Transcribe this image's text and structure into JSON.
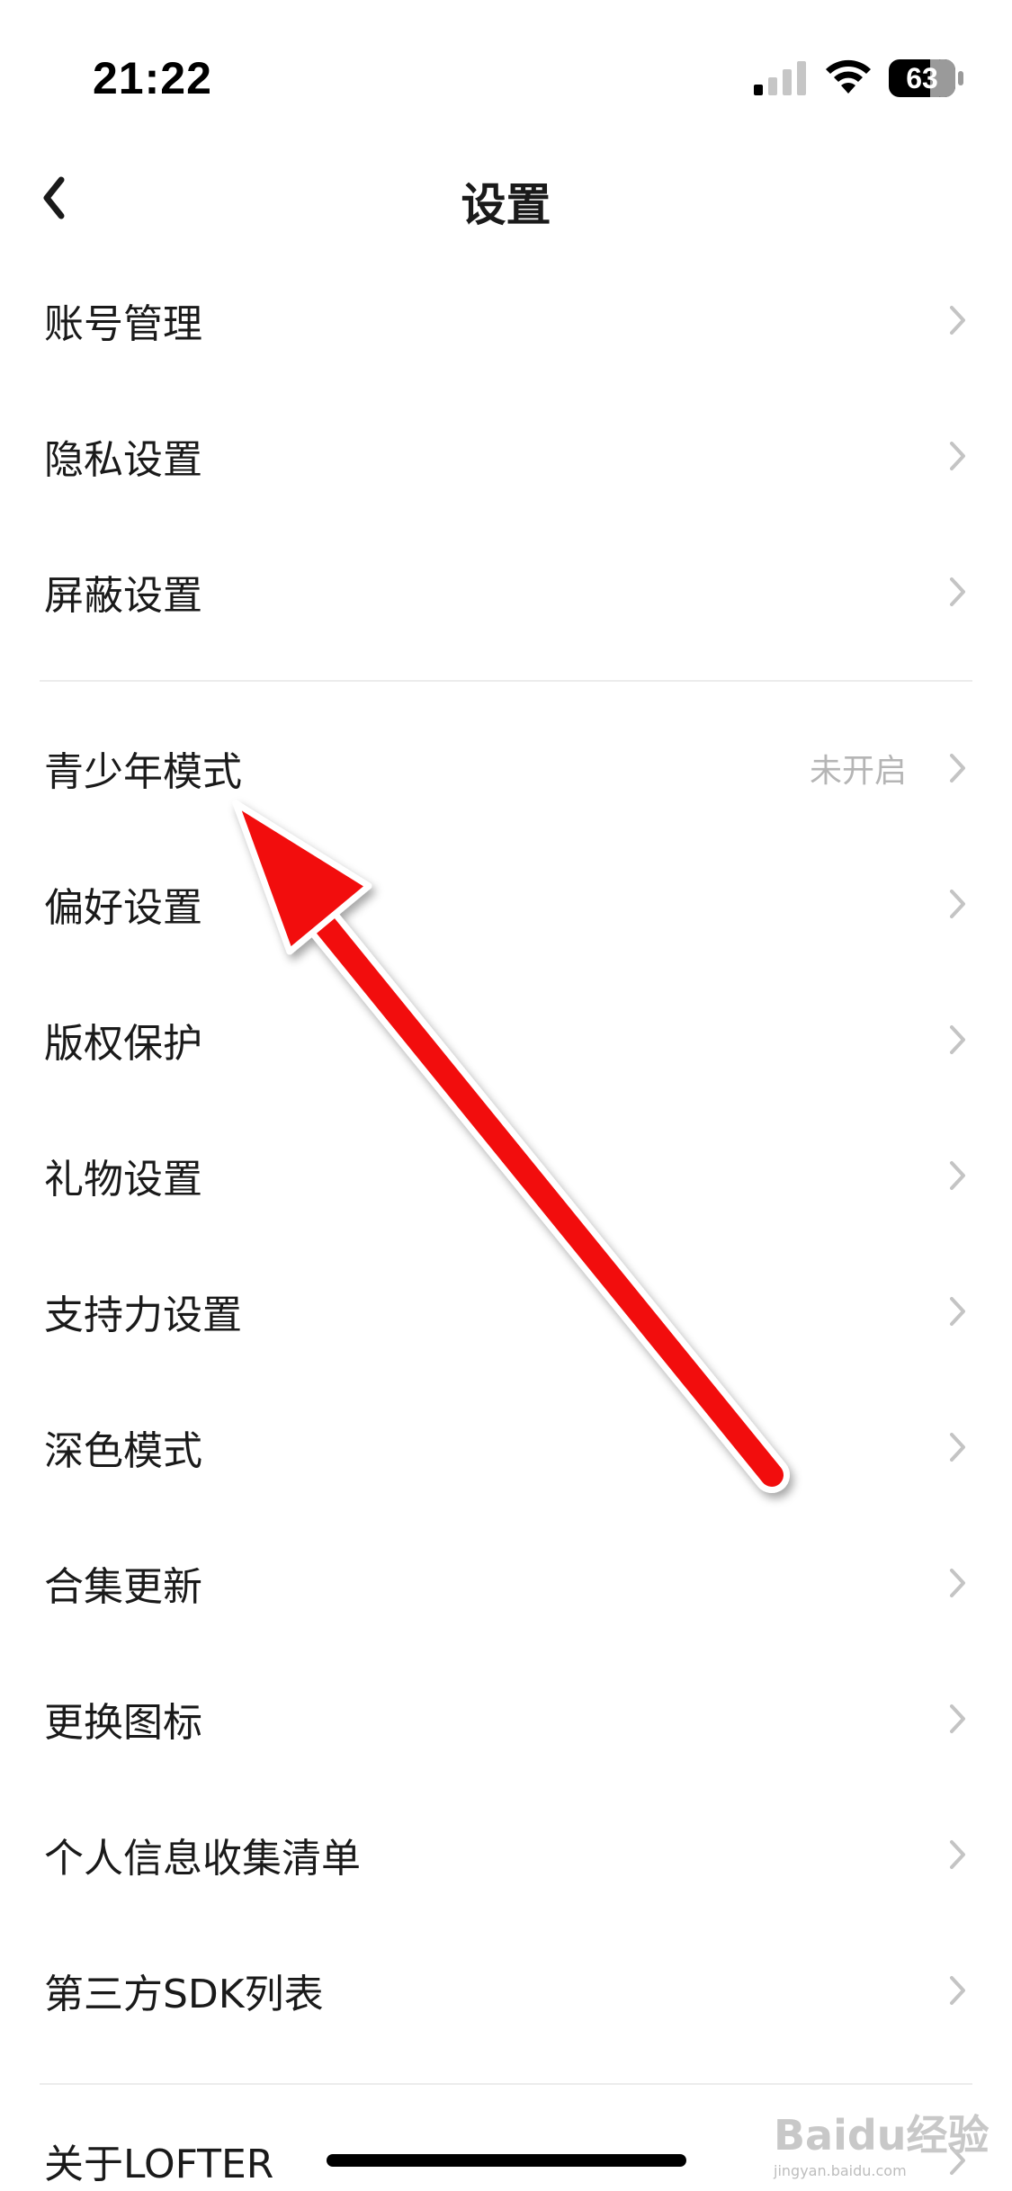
{
  "status_bar": {
    "time": "21:22",
    "battery": "63",
    "icons": [
      "signal-icon",
      "wifi-icon",
      "battery-icon"
    ]
  },
  "nav": {
    "title": "设置",
    "back_icon": "chevron-left-icon"
  },
  "groups": [
    {
      "items": [
        {
          "label": "账号管理"
        },
        {
          "label": "隐私设置"
        },
        {
          "label": "屏蔽设置"
        }
      ]
    },
    {
      "items": [
        {
          "label": "青少年模式",
          "value": "未开启"
        },
        {
          "label": "偏好设置"
        },
        {
          "label": "版权保护"
        },
        {
          "label": "礼物设置"
        },
        {
          "label": "支持力设置"
        },
        {
          "label": "深色模式"
        },
        {
          "label": "合集更新"
        },
        {
          "label": "更换图标"
        },
        {
          "label": "个人信息收集清单"
        },
        {
          "label": "第三方SDK列表"
        }
      ]
    },
    {
      "items": [
        {
          "label": "关于LOFTER"
        }
      ]
    }
  ],
  "overlay": {
    "annotation_arrow_color": "#f20d0d"
  },
  "watermark": {
    "brand": "Baidu经验",
    "url": "jingyan.baidu.com"
  },
  "colors": {
    "text": "#1a1a1a",
    "secondary": "#b5b5b5",
    "chevron": "#c4c4c4",
    "divider": "#ececec"
  }
}
